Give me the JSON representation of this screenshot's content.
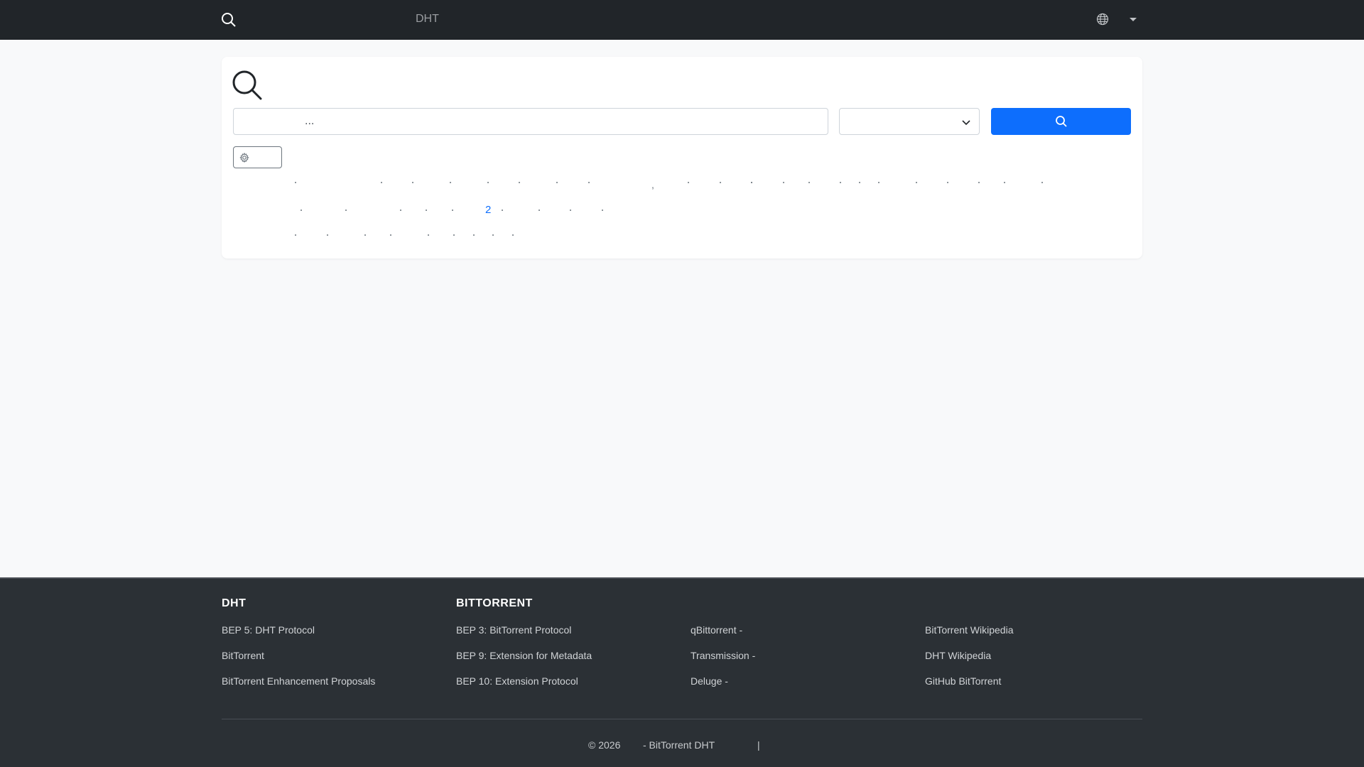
{
  "navbar": {
    "title": "DHT",
    "icons": [
      "search-icon",
      "globe-icon",
      "caret-down-icon"
    ]
  },
  "search": {
    "placeholder": "...",
    "select_value": "",
    "icons": [
      "search-icon",
      "chevron-down-icon",
      "gear-icon"
    ]
  },
  "hints": {
    "row2_link": "2",
    "row1_comma": ","
  },
  "footer": {
    "columns": [
      {
        "heading": "DHT",
        "links": [
          "BEP 5: DHT Protocol",
          "BitTorrent",
          "BitTorrent Enhancement Proposals"
        ]
      },
      {
        "heading": "BITTORRENT",
        "links": [
          "BEP 3: BitTorrent Protocol",
          "BEP 9: Extension for Metadata",
          "BEP 10: Extension Protocol"
        ]
      },
      {
        "heading": "",
        "links": [
          "qBittorrent -",
          "Transmission -",
          "Deluge -"
        ]
      },
      {
        "heading": "",
        "links": [
          "BitTorrent Wikipedia",
          "DHT Wikipedia",
          "GitHub BitTorrent"
        ]
      }
    ],
    "copyright": "© 2026",
    "copyright_site": "- BitTorrent DHT",
    "separator": "|"
  },
  "colors": {
    "navbar": "#212529",
    "primary": "#0d6efd",
    "footer": "#2b3035",
    "page_bg": "#f8f9fa"
  }
}
